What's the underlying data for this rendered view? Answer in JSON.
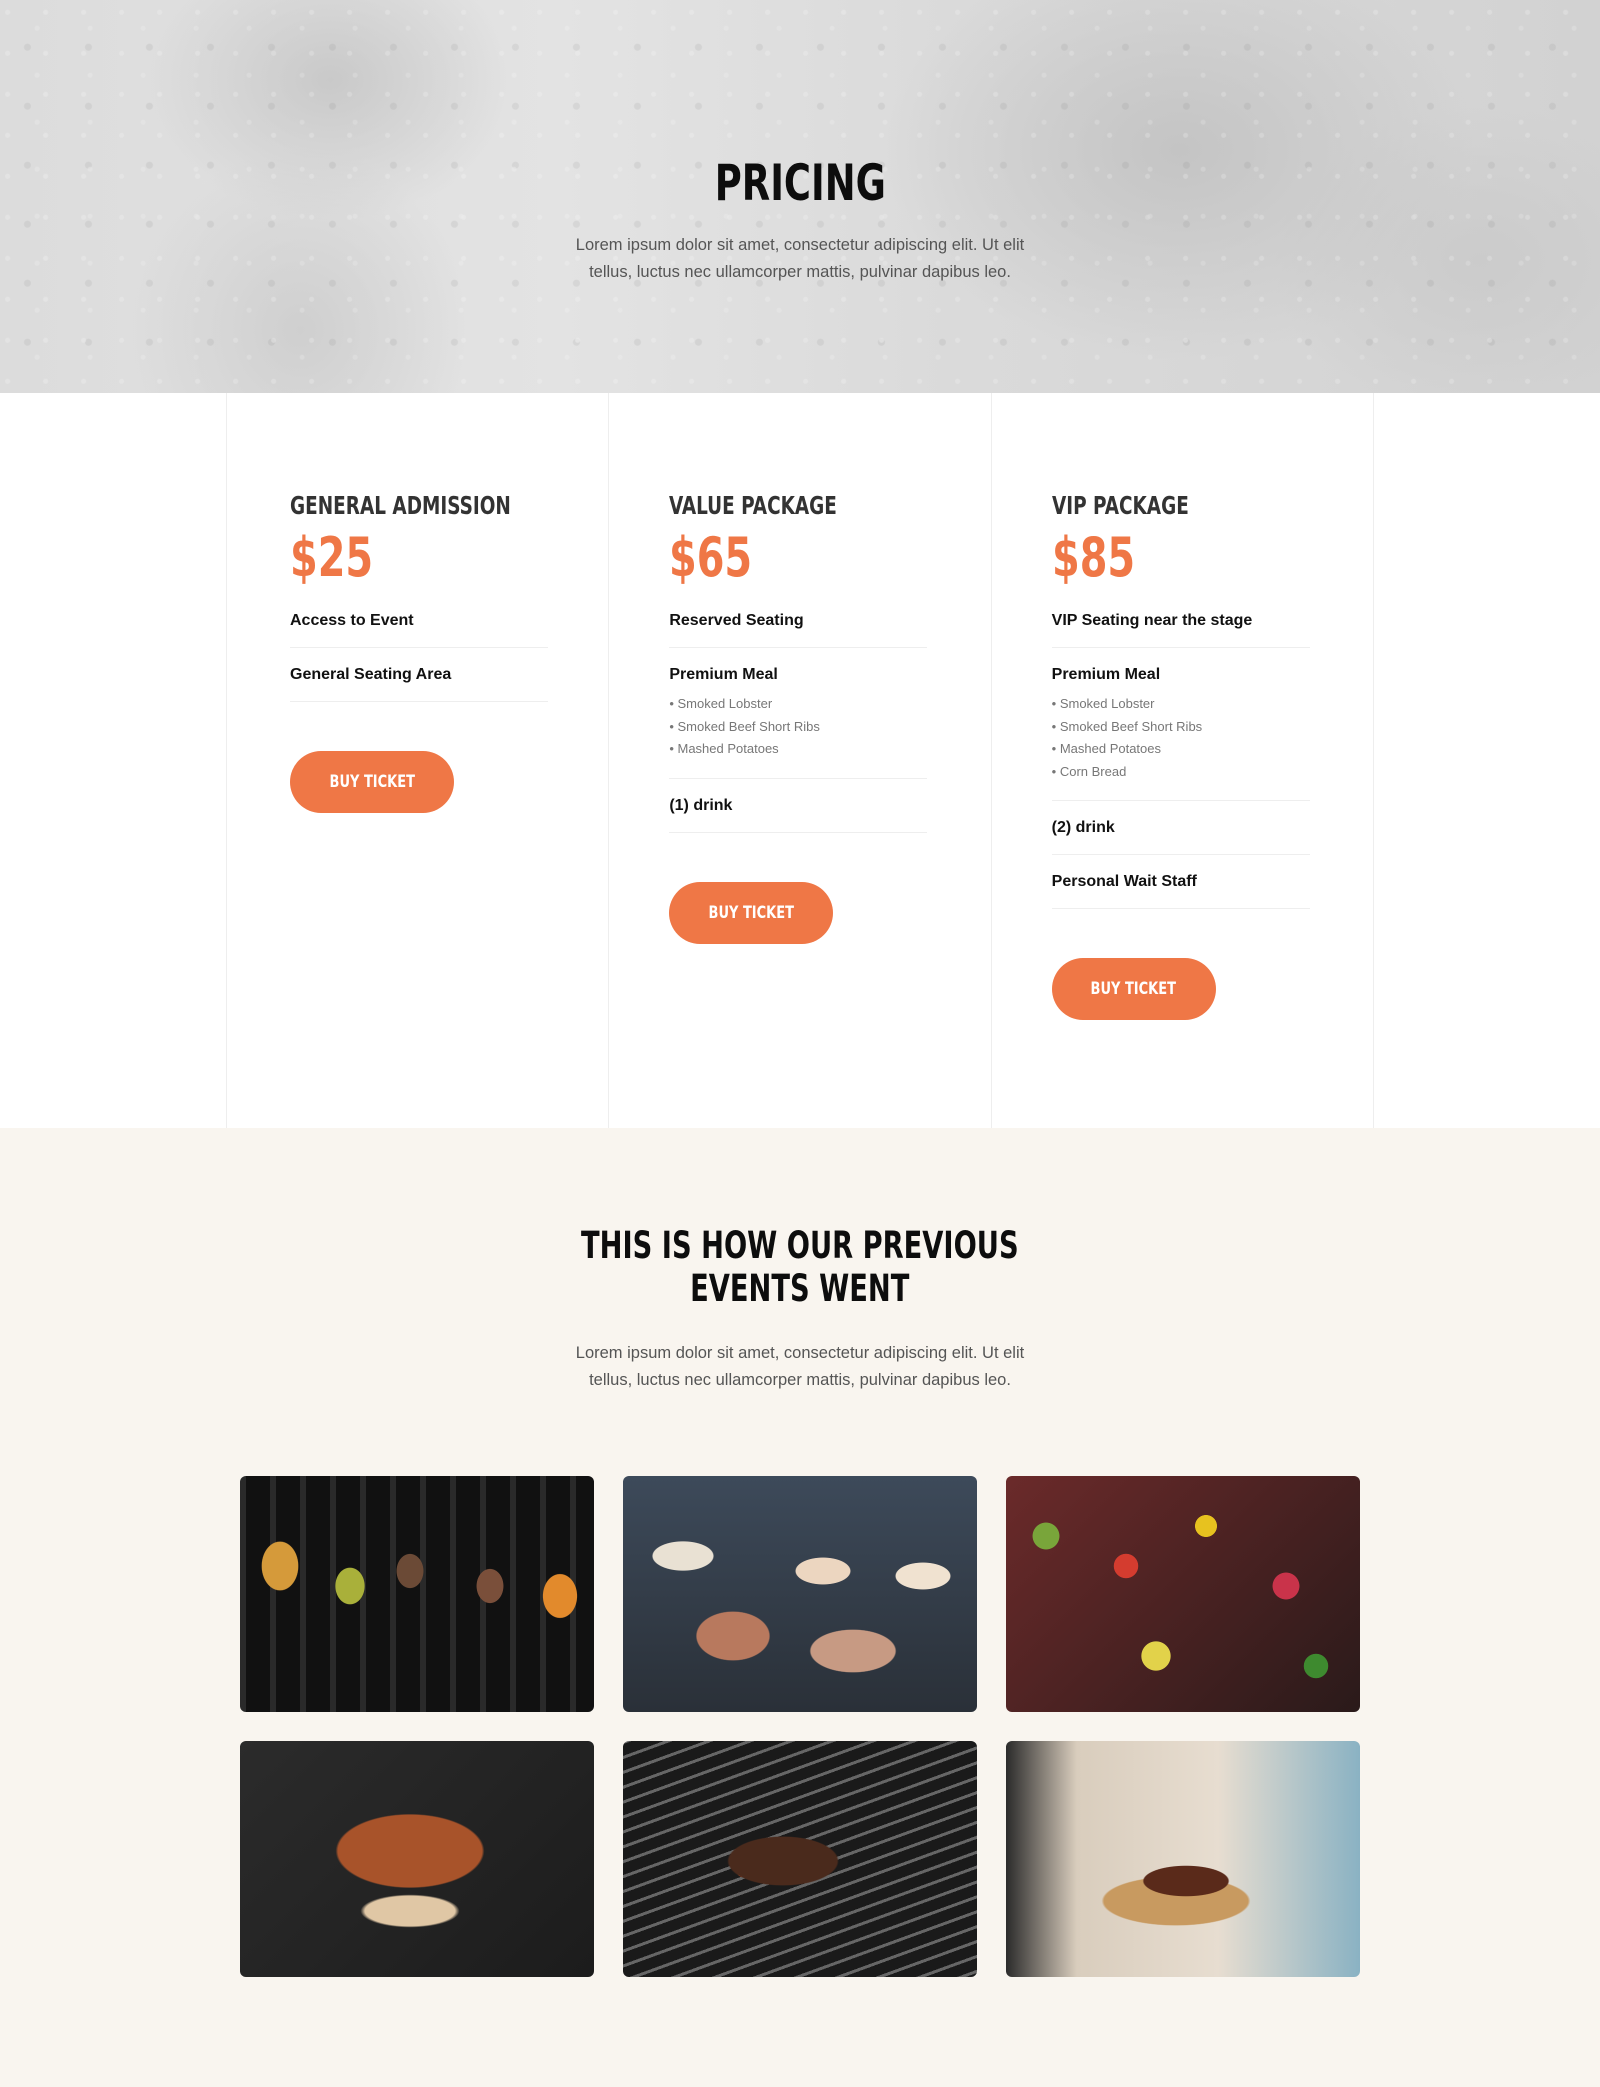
{
  "hero": {
    "title": "PRICING",
    "description": "Lorem ipsum dolor sit amet, consectetur adipiscing elit. Ut elit tellus, luctus nec ullamcorper mattis, pulvinar dapibus leo."
  },
  "plans": [
    {
      "name": "GENERAL ADMISSION",
      "price": "$25",
      "features": [
        {
          "title": "Access to Event",
          "items": []
        },
        {
          "title": "General Seating Area",
          "items": []
        }
      ],
      "button": "BUY TICKET"
    },
    {
      "name": "VALUE PACKAGE",
      "price": "$65",
      "features": [
        {
          "title": "Reserved Seating",
          "items": []
        },
        {
          "title": "Premium Meal",
          "items": [
            "Smoked Lobster",
            "Smoked Beef Short Ribs",
            "Mashed Potatoes"
          ]
        },
        {
          "title": "(1) drink",
          "items": []
        }
      ],
      "button": "BUY TICKET"
    },
    {
      "name": "VIP PACKAGE",
      "price": "$85",
      "features": [
        {
          "title": "VIP Seating near the stage",
          "items": []
        },
        {
          "title": "Premium Meal",
          "items": [
            "Smoked Lobster",
            "Smoked Beef Short Ribs",
            "Mashed Potatoes",
            "Corn Bread"
          ]
        },
        {
          "title": "(2) drink",
          "items": []
        },
        {
          "title": "Personal Wait Staff",
          "items": []
        }
      ],
      "button": "BUY TICKET"
    }
  ],
  "events": {
    "title_line1": "THIS IS HOW OUR PREVIOUS",
    "title_line2": "EVENTS WENT",
    "description": "Lorem ipsum dolor sit amet, consectetur adipiscing elit. Ut elit tellus, luctus nec ullamcorper mattis, pulvinar dapibus leo.",
    "photos": [
      "grilled-vegetable-skewers-photo",
      "grill-seafood-meat-photo",
      "colorful-kebabs-photo",
      "smoked-ribs-photo",
      "grill-skewers-smoke-photo",
      "sliced-brisket-board-photo"
    ]
  },
  "colors": {
    "accent": "#ef7746",
    "events_background": "#f9f5ef"
  }
}
